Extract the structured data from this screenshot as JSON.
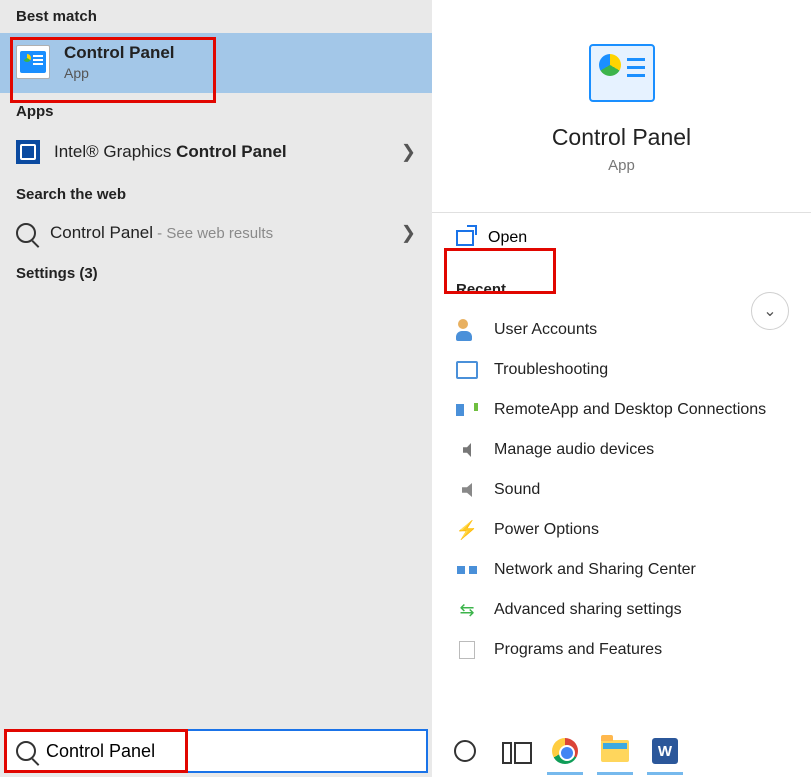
{
  "left": {
    "best_match_header": "Best match",
    "best_match": {
      "title": "Control Panel",
      "subtitle": "App"
    },
    "apps_header": "Apps",
    "apps_item": {
      "prefix": "Intel® Graphics ",
      "bold": "Control Panel"
    },
    "web_header": "Search the web",
    "web_item": {
      "label": "Control Panel",
      "hint": " - See web results"
    },
    "settings_header": "Settings (3)"
  },
  "search": {
    "value": "Control Panel"
  },
  "right": {
    "hero_title": "Control Panel",
    "hero_sub": "App",
    "open_label": "Open",
    "recent_header": "Recent",
    "recent": [
      {
        "label": "User Accounts"
      },
      {
        "label": "Troubleshooting"
      },
      {
        "label": "RemoteApp and Desktop Connections"
      },
      {
        "label": "Manage audio devices"
      },
      {
        "label": "Sound"
      },
      {
        "label": "Power Options"
      },
      {
        "label": "Network and Sharing Center"
      },
      {
        "label": "Advanced sharing settings"
      },
      {
        "label": "Programs and Features"
      }
    ]
  },
  "taskbar": {
    "word_glyph": "W"
  }
}
